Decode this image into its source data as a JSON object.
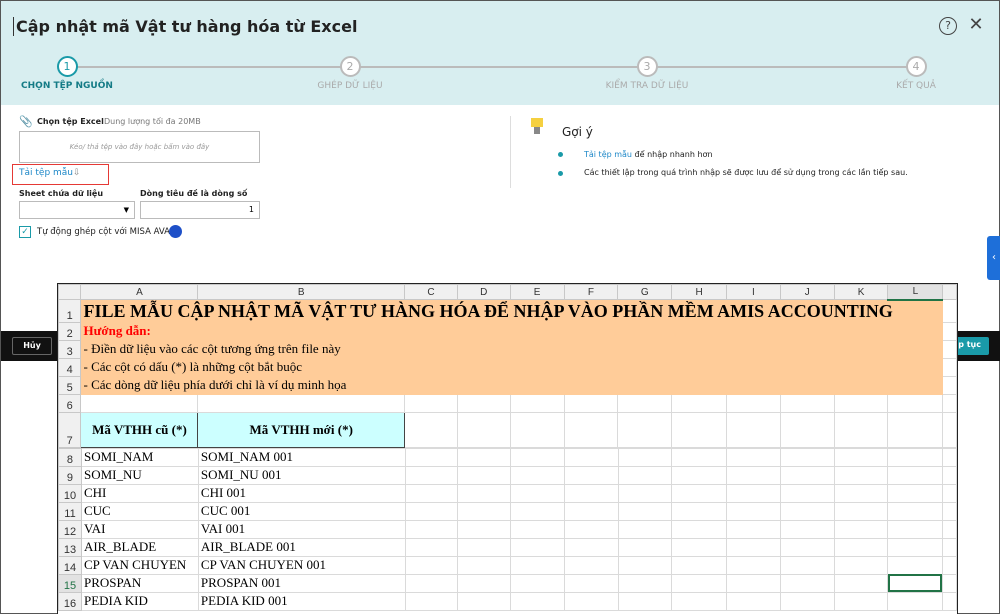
{
  "dialog": {
    "title": "Cập nhật mã Vật tư hàng hóa từ Excel",
    "help_icon": "?",
    "close_icon": "✕"
  },
  "steps": [
    {
      "num": "1",
      "label": "CHỌN TỆP NGUỒN"
    },
    {
      "num": "2",
      "label": "GHÉP DỮ LIỆU"
    },
    {
      "num": "3",
      "label": "KIỂM TRA DỮ LIỆU"
    },
    {
      "num": "4",
      "label": "KẾT QUẢ"
    }
  ],
  "form": {
    "choose_file": "Chọn tệp Excel",
    "max_size": "Dung lượng tối đa 20MB",
    "drop_placeholder": "Kéo/ thả tệp vào đây hoặc bấm vào đây",
    "download_template": "Tải tệp mẫu",
    "download_icon": "⇩",
    "sheet_label": "Sheet chứa dữ liệu",
    "sheet_value": "",
    "header_row_label": "Dòng tiêu đề là dòng số",
    "header_row_value": "1",
    "auto_map_label": "Tự động ghép cột với MISA AVA",
    "auto_map_checked": true
  },
  "hint": {
    "title": "Gợi ý",
    "items": [
      {
        "link": "Tải tệp mẫu",
        "text": " để nhập nhanh hơn"
      },
      {
        "link": "",
        "text": "Các thiết lập trong quá trình nhập sẽ được lưu để sử dụng trong các lần tiếp sau."
      }
    ]
  },
  "footer": {
    "cancel": "Hủy",
    "next": "p tục"
  },
  "sheet": {
    "columns": [
      "A",
      "B",
      "C",
      "D",
      "E",
      "F",
      "G",
      "H",
      "I",
      "J",
      "K",
      "L"
    ],
    "title": "FILE MẪU CẬP NHẬT MÃ VẬT TƯ HÀNG HÓA ĐỂ NHẬP VÀO PHẦN MỀM AMIS ACCOUNTING",
    "guide": "Hướng dẫn:",
    "guide_lines": [
      "- Điền dữ liệu vào các cột tương ứng trên file này",
      "- Các cột có dấu (*) là những cột bắt buộc",
      "- Các dòng dữ liệu phía dưới chỉ là ví dụ minh họa"
    ],
    "headers": [
      "Mã VTHH cũ (*)",
      "Mã VTHH mới (*)"
    ],
    "rows": [
      [
        "SOMI_NAM",
        "SOMI_NAM 001"
      ],
      [
        "SOMI_NU",
        "SOMI_NU 001"
      ],
      [
        "CHI",
        "CHI 001"
      ],
      [
        "CUC",
        "CUC 001"
      ],
      [
        "VAI",
        "VAI 001"
      ],
      [
        "AIR_BLADE",
        "AIR_BLADE 001"
      ],
      [
        "CP VAN CHUYEN",
        "CP VAN CHUYEN 001"
      ],
      [
        "PROSPAN",
        "PROSPAN 001"
      ],
      [
        "PEDIA KID",
        "PEDIA KID 001"
      ]
    ],
    "row_numbers": [
      "1",
      "2",
      "3",
      "4",
      "5",
      "6",
      "7",
      "8",
      "9",
      "10",
      "11",
      "12",
      "13",
      "14",
      "15",
      "16"
    ]
  }
}
